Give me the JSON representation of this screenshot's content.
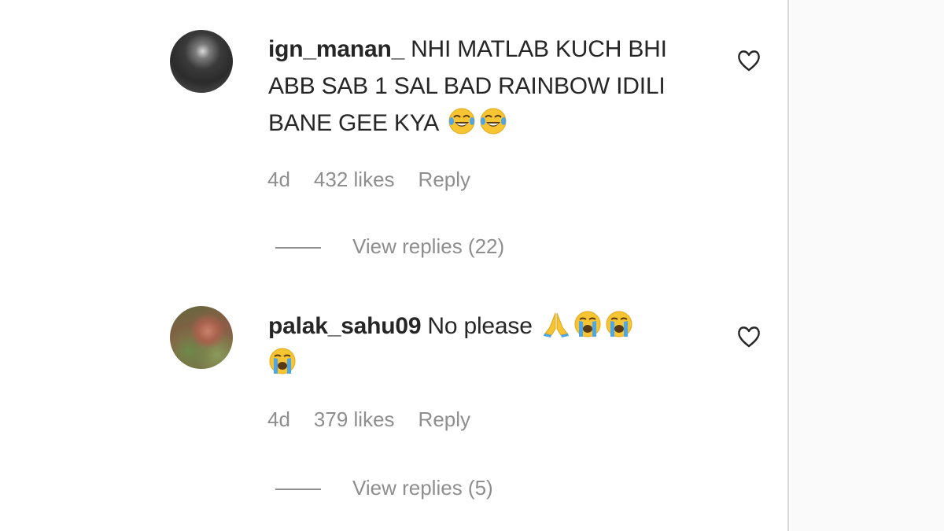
{
  "comments": [
    {
      "username": "ign_manan_",
      "text": "NHI MATLAB KUCH BHI ABB SAB 1 SAL BAD RAINBOW IDILI BANE GEE KYA",
      "emojis": [
        "joy-emoji",
        "joy-emoji"
      ],
      "age": "4d",
      "likes": "432 likes",
      "reply_label": "Reply",
      "view_replies": "View replies (22)"
    },
    {
      "username": "palak_sahu09",
      "text": "No please",
      "emojis": [
        "folded-hands-emoji",
        "loudly-crying-emoji",
        "loudly-crying-emoji",
        "loudly-crying-emoji"
      ],
      "age": "4d",
      "likes": "379 likes",
      "reply_label": "Reply",
      "view_replies": "View replies (5)"
    }
  ],
  "icons": {
    "like": "heart-outline-icon"
  },
  "colors": {
    "text": "#262626",
    "secondary": "#8e8e8e",
    "divider": "#dbdbdb",
    "emoji_yellow": "#f7c531",
    "emoji_tear": "#4da6e8"
  }
}
